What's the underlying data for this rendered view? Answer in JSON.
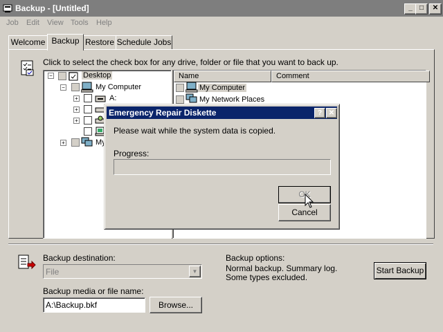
{
  "window": {
    "title": "Backup - [Untitled]",
    "min_btn": "_",
    "max_btn": "□",
    "close_btn": "✕"
  },
  "menu": [
    "Job",
    "Edit",
    "View",
    "Tools",
    "Help"
  ],
  "tabs": [
    "Welcome",
    "Backup",
    "Restore",
    "Schedule Jobs"
  ],
  "active_tab": "Backup",
  "instruction": "Click to select the check box for any drive, folder or file that you want to back up.",
  "tree": {
    "root": "Desktop",
    "computer": "My Computer",
    "drive_a": "A:",
    "network_partial": "My"
  },
  "list": {
    "columns": [
      "Name",
      "Comment"
    ],
    "rows": [
      "My Computer",
      "My Network Places"
    ]
  },
  "dialog": {
    "title": "Emergency Repair Diskette",
    "help_btn": "?",
    "close_btn": "✕",
    "message": "Please wait while the system data is copied.",
    "progress_label": "Progress:",
    "progress": 0,
    "ok_label": "OK",
    "cancel_label": "Cancel"
  },
  "bottom": {
    "destination_label": "Backup destination:",
    "destination_value": "File",
    "media_label": "Backup media or file name:",
    "media_value": "A:\\Backup.bkf",
    "browse_label": "Browse...",
    "options_label": "Backup options:",
    "options_line1": "Normal backup.  Summary log.",
    "options_line2": "Some types excluded.",
    "start_label": "Start Backup"
  },
  "colors": {
    "titlebar_inactive": "#7e7e7e",
    "dialog_titlebar": "#0a246a",
    "face": "#d4d0c8"
  }
}
